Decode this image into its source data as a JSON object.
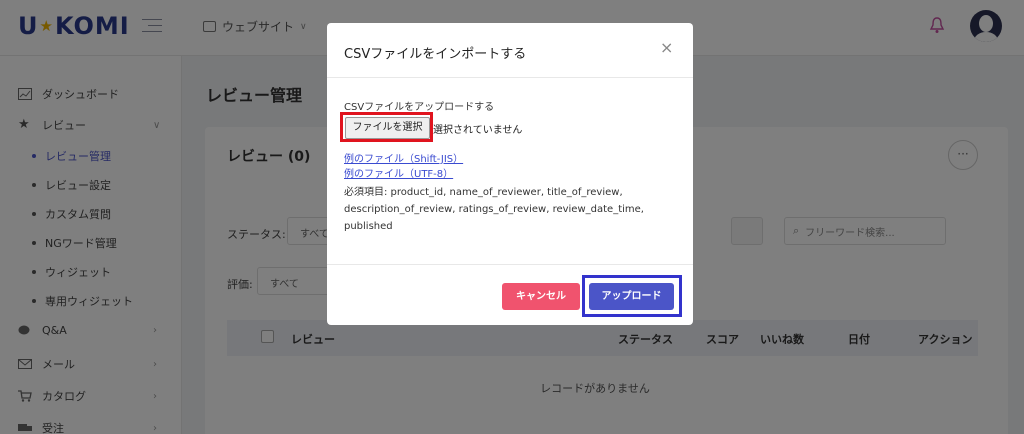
{
  "app": {
    "logo_left": "U",
    "logo_star": "★",
    "logo_right": "KOMI"
  },
  "header": {
    "site_selector": "ウェブサイト"
  },
  "sidebar": {
    "items": [
      {
        "label": "ダッシュボード",
        "icon": "chart-icon"
      },
      {
        "label": "レビュー",
        "icon": "star-icon"
      },
      {
        "label": "Q&A",
        "icon": "chat-icon"
      },
      {
        "label": "メール",
        "icon": "mail-icon"
      },
      {
        "label": "カタログ",
        "icon": "cart-icon"
      },
      {
        "label": "受注",
        "icon": "truck-icon"
      }
    ],
    "sub_items": [
      "レビュー管理",
      "レビュー設定",
      "カスタム質問",
      "NGワード管理",
      "ウィジェット",
      "専用ウィジェット"
    ]
  },
  "page": {
    "title": "レビュー管理"
  },
  "card": {
    "title": "レビュー (0)",
    "status_label": "ステータス:",
    "status_value": "すべて",
    "rating_label": "評価:",
    "rating_value": "すべて",
    "search_placeholder": "フリーワード検索..."
  },
  "table": {
    "columns": [
      "レビュー",
      "ステータス",
      "スコア",
      "いいね数",
      "日付",
      "アクション"
    ],
    "empty_text": "レコードがありません"
  },
  "modal": {
    "title": "CSVファイルをインポートする",
    "close": "×",
    "upload_label": "CSVファイルをアップロードする",
    "file_button": "ファイルを選択",
    "file_status": "選択されていません",
    "link_sjis": "例のファイル（Shift-JIS）",
    "link_utf8": "例のファイル（UTF-8）",
    "required_fields": "必須項目: product_id, name_of_reviewer, title_of_review, description_of_review, ratings_of_review, review_date_time, published",
    "cancel_label": "キャンセル",
    "upload_button": "アップロード"
  },
  "colors": {
    "accent": "#4b55c8",
    "cancel": "#f0536e",
    "highlight_red": "#e0141e",
    "highlight_blue": "#3333cc"
  }
}
